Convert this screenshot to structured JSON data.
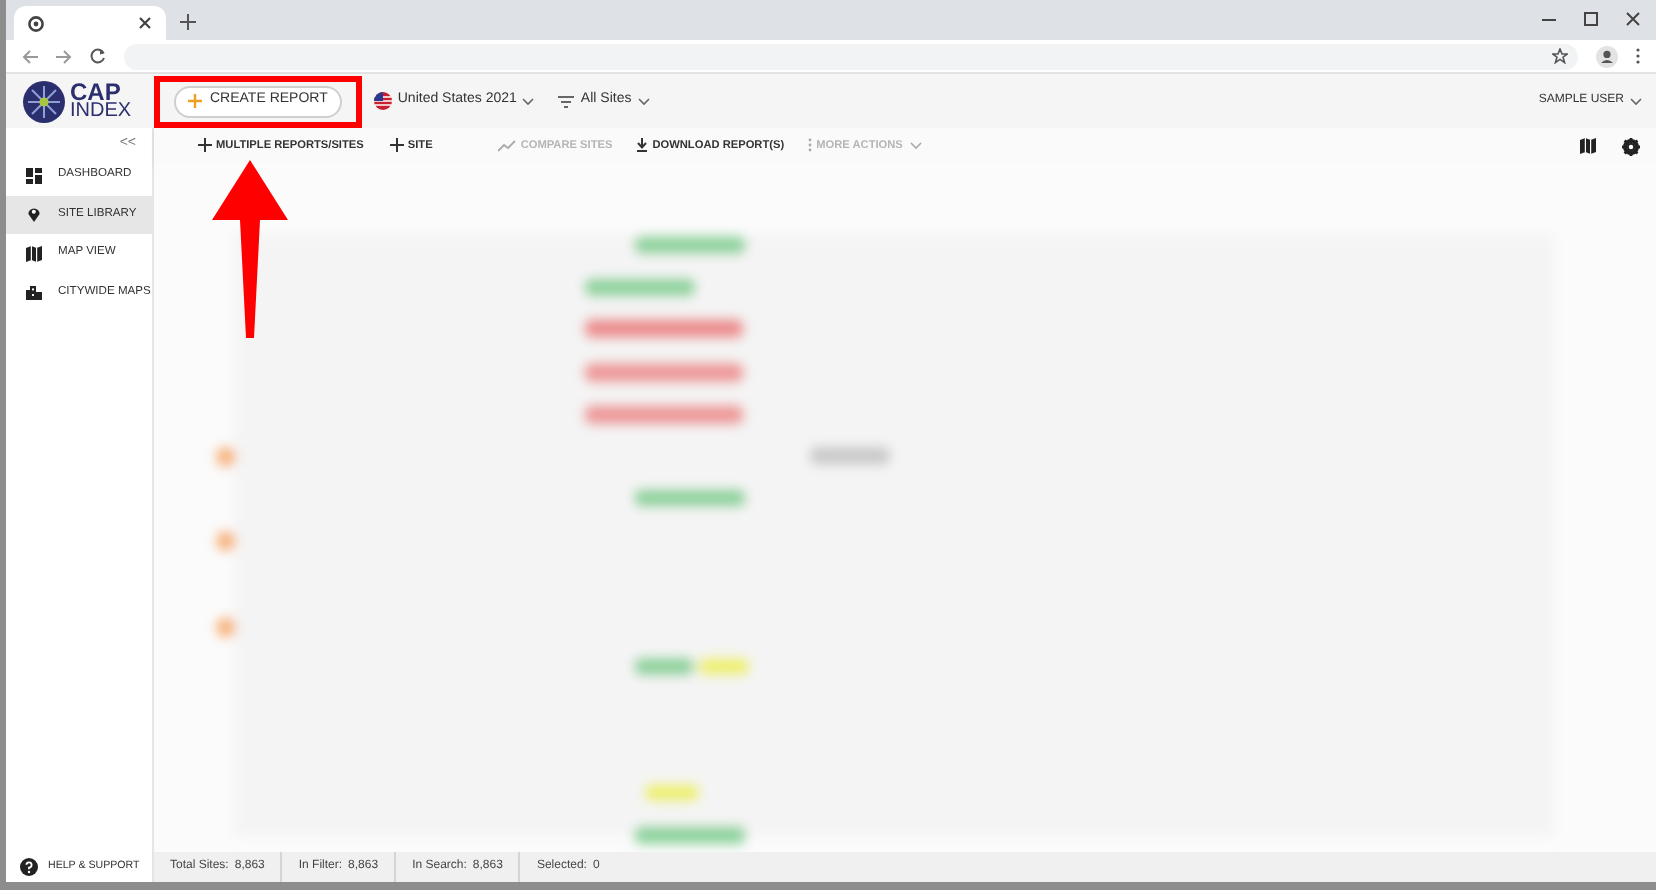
{
  "app_header": {
    "logo": {
      "line_1": "CAP",
      "line_2": "INDEX"
    },
    "create_report": {
      "label": "CREATE REPORT",
      "highlighted": true
    },
    "dataset": "United States 2021",
    "filter": "All Sites",
    "user": "SAMPLE USER"
  },
  "sidebar": {
    "collapse": "<<",
    "items": [
      {
        "label": "DASHBOARD",
        "selected": false
      },
      {
        "label": "SITE LIBRARY",
        "selected": true
      },
      {
        "label": "MAP VIEW",
        "selected": false
      },
      {
        "label": "CITYWIDE MAPS",
        "selected": false
      }
    ],
    "help": "HELP & SUPPORT"
  },
  "toolbar": {
    "actions": [
      {
        "label": "MULTIPLE REPORTS/SITES",
        "disabled": false
      },
      {
        "label": "SITE",
        "disabled": false
      },
      {
        "label": "COMPARE SITES",
        "disabled": true
      },
      {
        "label": "DOWNLOAD REPORT(S)",
        "disabled": false
      },
      {
        "label": "MORE ACTIONS",
        "disabled": true
      }
    ]
  },
  "status_bar": [
    {
      "label": "Total Sites:",
      "value": "8,863"
    },
    {
      "label": "In Filter:",
      "value": "8,863"
    },
    {
      "label": "In Search:",
      "value": "8,863"
    },
    {
      "label": "Selected:",
      "value": "0"
    }
  ]
}
